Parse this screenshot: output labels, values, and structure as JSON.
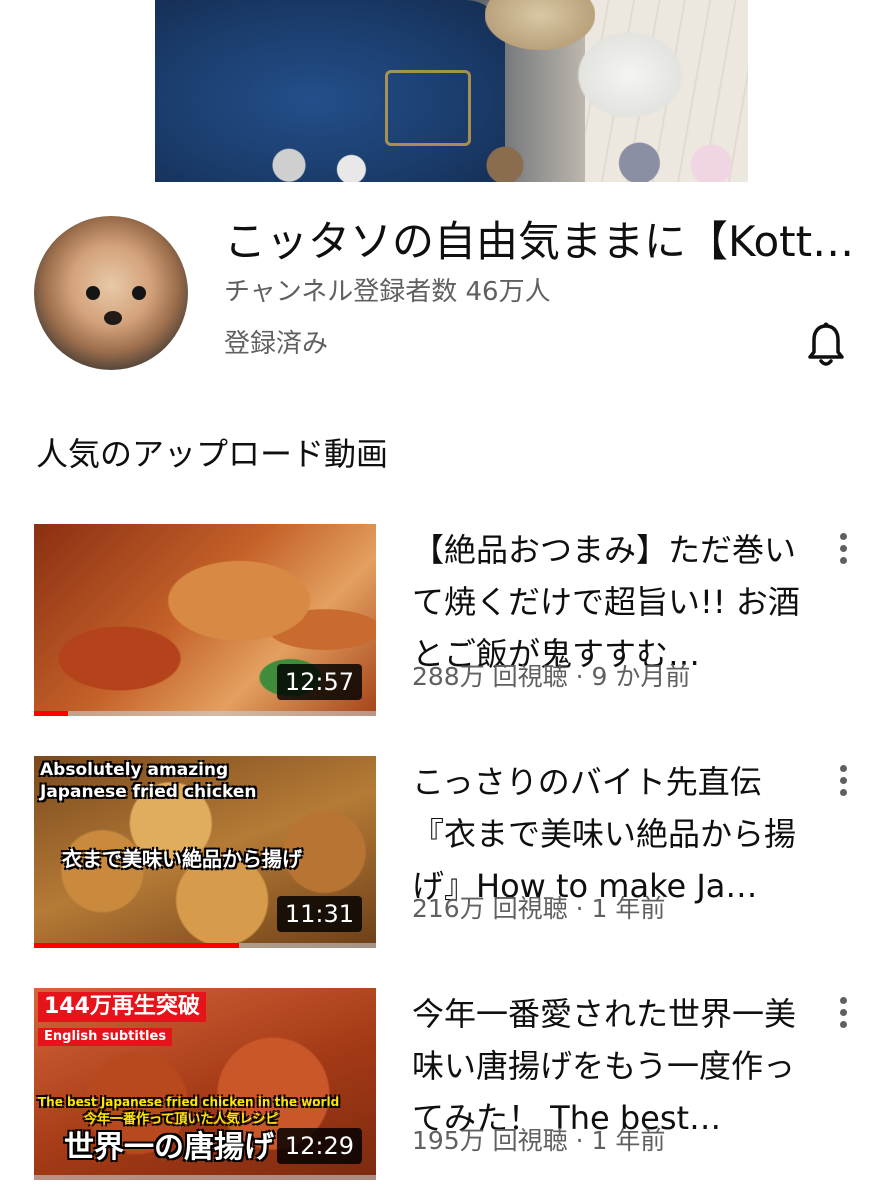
{
  "channel": {
    "name": "こッタソの自由気ままに【Kotta…",
    "subscribers": "チャンネル登録者数 46万人",
    "subscribed_label": "登録済み",
    "icons": {
      "avatar": "dog-avatar",
      "bell": "bell-icon"
    }
  },
  "section_title": "人気のアップロード動画",
  "videos": [
    {
      "title": "【絶品おつまみ】ただ巻いて焼くだけで超旨い!! お酒とご飯が鬼すすむ…",
      "meta": "288万 回視聴 · 9 か月前",
      "duration": "12:57",
      "progress": 0.1,
      "thumbnail_text": []
    },
    {
      "title": "こっさりのバイト先直伝『衣まで美味い絶品から揚げ』How to make Ja…",
      "meta": "216万 回視聴 · 1 年前",
      "duration": "11:31",
      "progress": 0.6,
      "thumbnail_text": [
        "Absolutely amazing",
        "Japanese fried chicken",
        "衣まで美味い絶品から揚げ"
      ]
    },
    {
      "title": "今年一番愛された世界一美味い唐揚げをもう一度作ってみた！ The best…",
      "meta": "195万 回視聴 · 1 年前",
      "duration": "12:29",
      "progress": 0.0,
      "thumbnail_text": [
        "144万再生突破",
        "English subtitles",
        "The best Japanese fried chicken in the world",
        "今年一番作って頂いた人気レシピ",
        "世界一の唐揚げ"
      ]
    }
  ],
  "colors": {
    "progress": "#ff0000",
    "secondary_text": "#606060",
    "primary_text": "#0f0f0f"
  }
}
